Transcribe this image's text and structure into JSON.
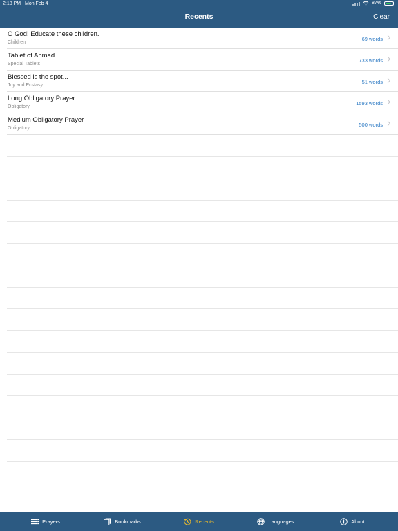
{
  "status_bar": {
    "time": "2:18 PM",
    "date": "Mon Feb 4",
    "battery": "87%",
    "battery_level": 0.87
  },
  "nav": {
    "title": "Recents",
    "clear_label": "Clear"
  },
  "recents": [
    {
      "title": "O God! Educate these children.",
      "subtitle": "Children",
      "words": "69 words"
    },
    {
      "title": "Tablet of Ahmad",
      "subtitle": "Special Tablets",
      "words": "733 words"
    },
    {
      "title": "Blessed is the spot...",
      "subtitle": "Joy and Ecstasy",
      "words": "51 words"
    },
    {
      "title": "Long Obligatory Prayer",
      "subtitle": "Obligatory",
      "words": "1593 words"
    },
    {
      "title": "Medium Obligatory Prayer",
      "subtitle": "Obligatory",
      "words": "500 words"
    }
  ],
  "tabs": {
    "prayers": "Prayers",
    "bookmarks": "Bookmarks",
    "recents": "Recents",
    "languages": "Languages",
    "about": "About"
  },
  "colors": {
    "bar": "#2c5a82",
    "active_tab": "#e8b92c",
    "word_count": "#2e7bc4"
  },
  "icons": {
    "prayers": "list-icon",
    "bookmarks": "bookmarks-icon",
    "recents": "history-icon",
    "languages": "globe-icon",
    "about": "info-icon"
  }
}
